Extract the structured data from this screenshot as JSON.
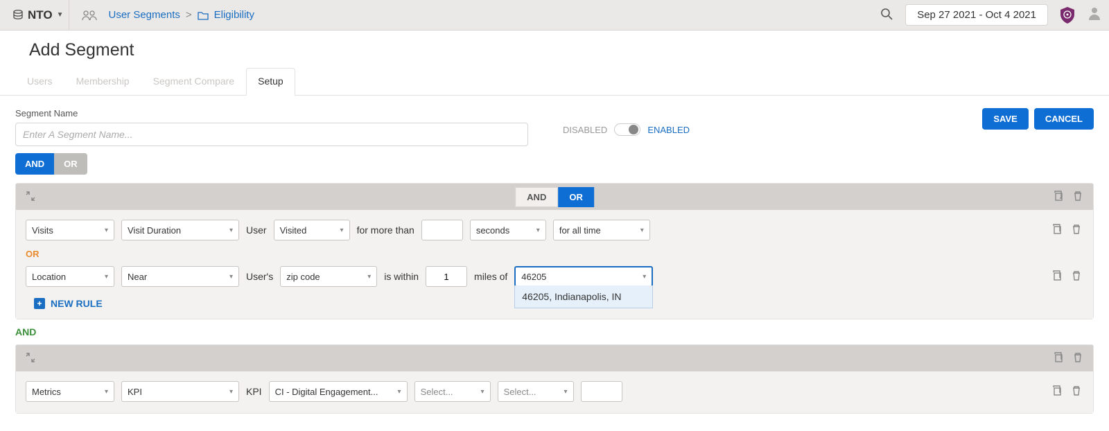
{
  "topbar": {
    "org": "NTO",
    "breadcrumb": {
      "segment1": "User Segments",
      "sep": ">",
      "segment2": "Eligibility"
    },
    "daterange": "Sep 27 2021 - Oct 4 2021"
  },
  "page": {
    "title": "Add Segment"
  },
  "tabs": {
    "users": "Users",
    "membership": "Membership",
    "compare": "Segment Compare",
    "setup": "Setup"
  },
  "form": {
    "segment_name_label": "Segment Name",
    "segment_name_placeholder": "Enter A Segment Name...",
    "disabled": "DISABLED",
    "enabled": "ENABLED",
    "save": "SAVE",
    "cancel": "CANCEL"
  },
  "bool": {
    "and": "AND",
    "or": "OR"
  },
  "group1": {
    "rule1": {
      "metric": "Visits",
      "submetric": "Visit Duration",
      "label_user": "User",
      "condition": "Visited",
      "label_morethan": "for more than",
      "units": "seconds",
      "range": "for all time"
    },
    "sep_or": "OR",
    "rule2": {
      "metric": "Location",
      "submetric": "Near",
      "label_users": "User's",
      "field": "zip code",
      "label_within": "is within",
      "radius": "1",
      "label_milesof": "miles of",
      "zip_value": "46205",
      "zip_option": "46205, Indianapolis, IN"
    },
    "new_rule": "NEW RULE"
  },
  "between": "AND",
  "group2": {
    "rule1": {
      "metric": "Metrics",
      "submetric": "KPI",
      "label_kpi": "KPI",
      "kpi_value": "CI - Digital Engagement...",
      "select_ph": "Select..."
    }
  }
}
